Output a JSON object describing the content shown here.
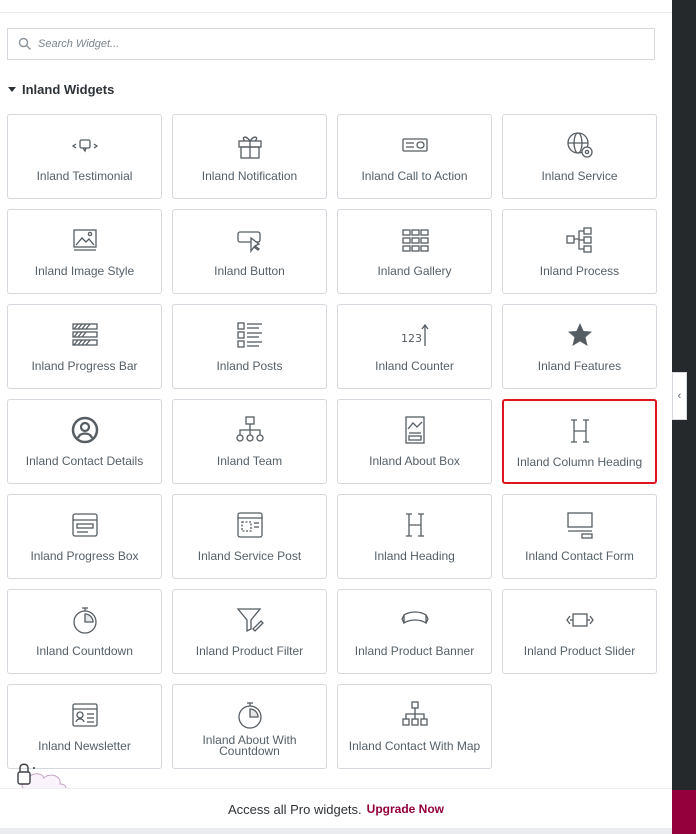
{
  "search": {
    "placeholder": "Search Widget..."
  },
  "category": {
    "title": "Inland Widgets"
  },
  "widgets": [
    {
      "label": "Inland Testimonial",
      "icon": "testimonial-icon"
    },
    {
      "label": "Inland Notification",
      "icon": "gift-icon"
    },
    {
      "label": "Inland Call to Action",
      "icon": "call-to-action-icon"
    },
    {
      "label": "Inland Service",
      "icon": "globe-gear-icon"
    },
    {
      "label": "Inland Image Style",
      "icon": "image-icon"
    },
    {
      "label": "Inland Button",
      "icon": "button-cursor-icon"
    },
    {
      "label": "Inland Gallery",
      "icon": "gallery-grid-icon"
    },
    {
      "label": "Inland Process",
      "icon": "process-icon"
    },
    {
      "label": "Inland Progress Bar",
      "icon": "progress-bar-icon"
    },
    {
      "label": "Inland Posts",
      "icon": "posts-list-icon"
    },
    {
      "label": "Inland Counter",
      "icon": "counter-icon"
    },
    {
      "label": "Inland Features",
      "icon": "star-icon"
    },
    {
      "label": "Inland Contact Details",
      "icon": "user-circle-icon"
    },
    {
      "label": "Inland Team",
      "icon": "org-chart-icon"
    },
    {
      "label": "Inland About Box",
      "icon": "about-box-icon"
    },
    {
      "label": "Inland Column Heading",
      "icon": "heading-icon"
    },
    {
      "label": "Inland Progress Box",
      "icon": "progress-box-icon"
    },
    {
      "label": "Inland Service Post",
      "icon": "service-post-icon"
    },
    {
      "label": "Inland Heading",
      "icon": "heading-icon"
    },
    {
      "label": "Inland Contact Form",
      "icon": "contact-form-icon"
    },
    {
      "label": "Inland Countdown",
      "icon": "stopwatch-icon"
    },
    {
      "label": "Inland Product Filter",
      "icon": "filter-icon"
    },
    {
      "label": "Inland Product Banner",
      "icon": "banner-icon"
    },
    {
      "label": "Inland Product Slider",
      "icon": "slider-icon"
    },
    {
      "label": "Inland Newsletter",
      "icon": "newsletter-icon"
    },
    {
      "label": "Inland About With Countdown",
      "icon": "stopwatch-icon"
    },
    {
      "label": "Inland Contact With Map",
      "icon": "sitemap-icon"
    }
  ],
  "selected_widget": "Inland Column Heading",
  "footer": {
    "text": "Access all Pro widgets.",
    "link": "Upgrade Now"
  },
  "colors": {
    "accent": "#93003c",
    "selection": "#e0141e",
    "sidebar": "#26292c"
  }
}
